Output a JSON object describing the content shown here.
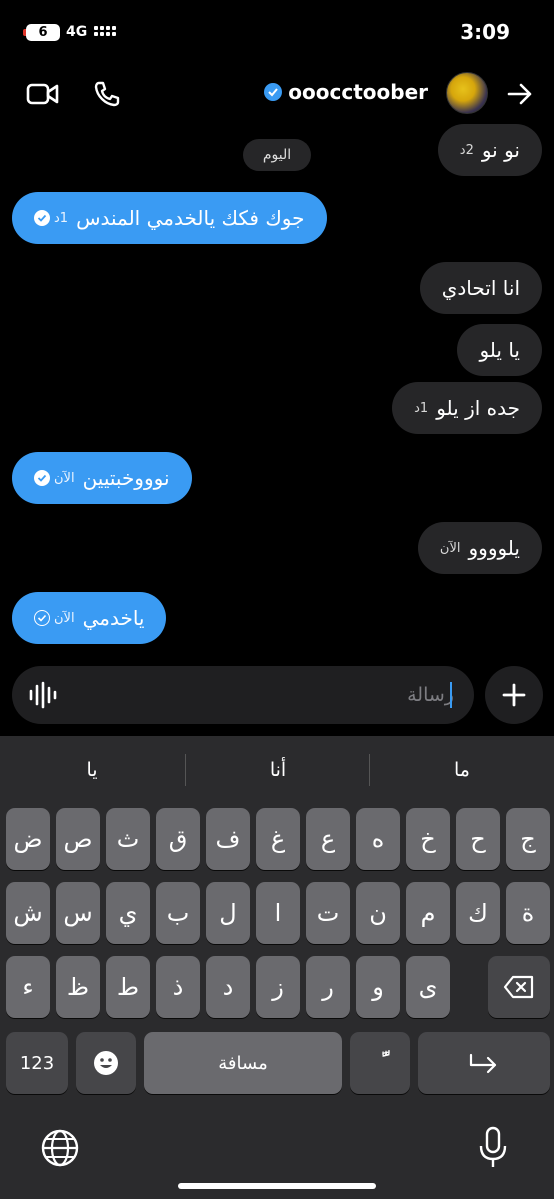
{
  "status_bar": {
    "battery": "6",
    "network": "4G",
    "time": "3:09"
  },
  "header": {
    "username": "ooocctoober"
  },
  "messages": {
    "day_label": "اليوم",
    "items": [
      {
        "text": "نو نو",
        "meta": "2د",
        "side": "received"
      },
      {
        "text": "جوك فكك يالخدمي المندس",
        "meta": "1د",
        "side": "sent"
      },
      {
        "text": "انا اتحادي",
        "meta": "",
        "side": "received"
      },
      {
        "text": "يا يلو",
        "meta": "",
        "side": "received"
      },
      {
        "text": "جده از يلو",
        "meta": "1د",
        "side": "received"
      },
      {
        "text": "نوووخبتيين",
        "meta": "الآن",
        "side": "sent"
      },
      {
        "text": "يلوووو",
        "meta": "الآن",
        "side": "received"
      },
      {
        "text": "ياخدمي",
        "meta": "الآن",
        "side": "sent"
      }
    ]
  },
  "composer": {
    "placeholder": "رسالة"
  },
  "keyboard": {
    "suggestions": [
      "يا",
      "أنا",
      "ما"
    ],
    "row1": [
      "ض",
      "ص",
      "ث",
      "ق",
      "ف",
      "غ",
      "ع",
      "ه",
      "خ",
      "ح",
      "ج"
    ],
    "row2": [
      "ش",
      "س",
      "ي",
      "ب",
      "ل",
      "ا",
      "ت",
      "ن",
      "م",
      "ك",
      "ة"
    ],
    "row3": [
      "ء",
      "ظ",
      "ط",
      "ذ",
      "د",
      "ز",
      "ر",
      "و",
      "ى"
    ],
    "numbers_label": "123",
    "space_label": "مسافة",
    "diacritic_label": "ًّ"
  },
  "colors": {
    "sent_bubble": "#3a9bf3",
    "received_bubble": "#262628",
    "keyboard_bg": "#2b2b2d"
  }
}
